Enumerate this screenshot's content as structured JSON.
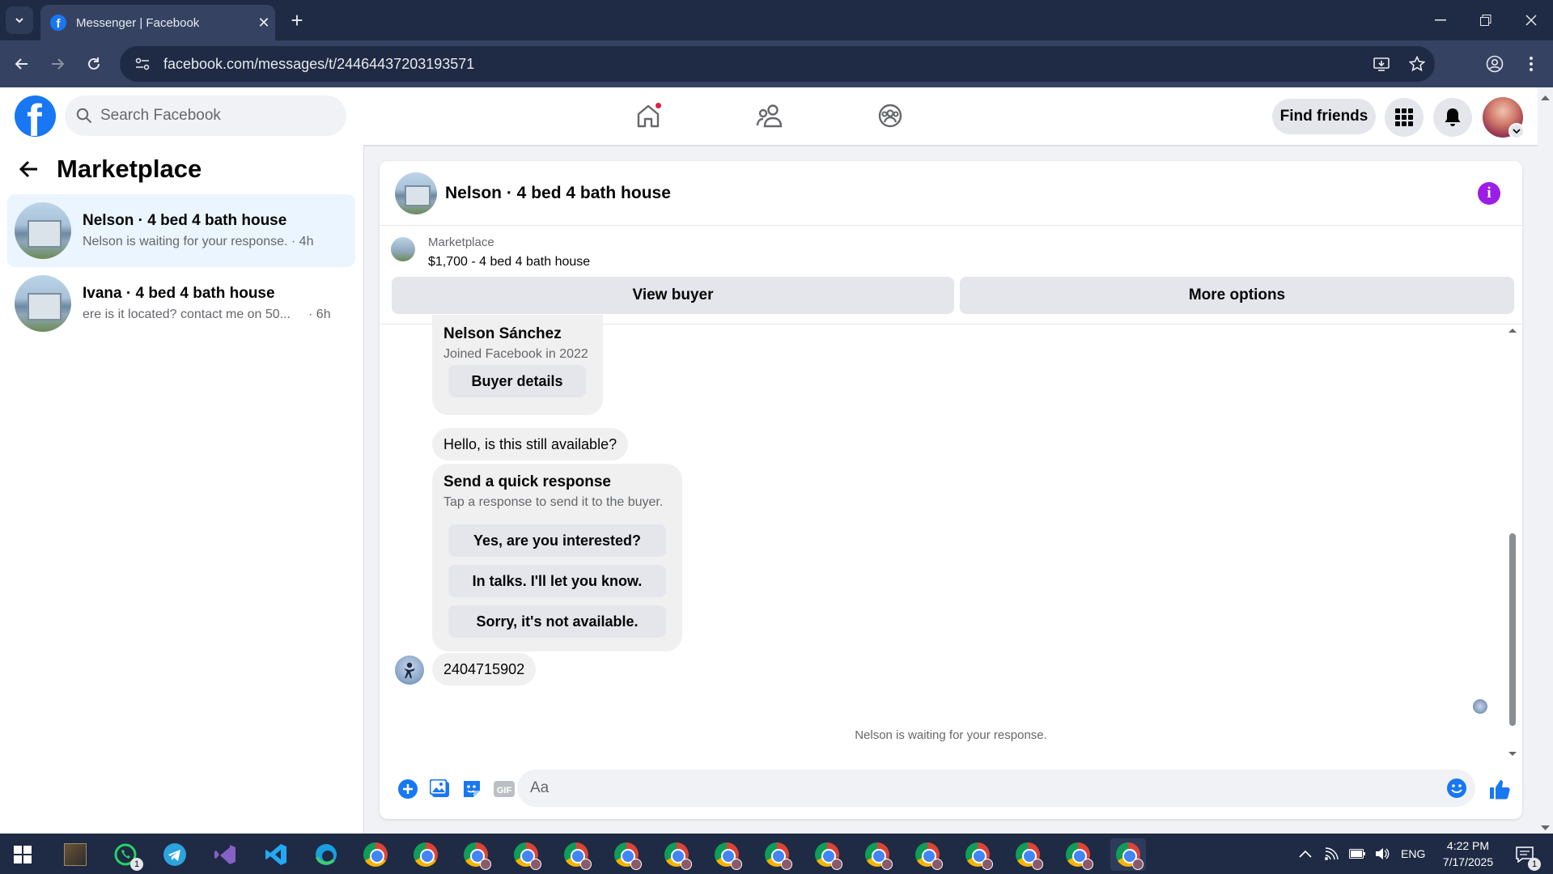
{
  "browser": {
    "tab_title": "Messenger | Facebook",
    "url": "facebook.com/messages/t/24464437203193571"
  },
  "header": {
    "search_placeholder": "Search Facebook",
    "find_friends_label": "Find friends",
    "home_has_notification": true
  },
  "sidebar": {
    "title": "Marketplace",
    "conversations": [
      {
        "name": "Nelson · 4 bed 4 bath house",
        "preview": "Nelson is waiting for your response. · 4h",
        "active": true
      },
      {
        "name": "Ivana · 4 bed 4 bath house",
        "preview": "ere is it located? contact me on 50...",
        "time": "· 6h",
        "active": false
      }
    ]
  },
  "chat": {
    "title": "Nelson · 4 bed 4 bath house",
    "listing_source": "Marketplace",
    "listing_price_title": "$1,700 - 4 bed 4 bath house",
    "view_buyer_label": "View buyer",
    "more_options_label": "More options",
    "buyer_card": {
      "name": "Nelson Sánchez",
      "joined": "Joined Facebook in 2022",
      "details_button": "Buyer details"
    },
    "message_1": "Hello, is this still available?",
    "quick_response": {
      "heading": "Send a quick response",
      "subtext": "Tap a response to send it to the buyer.",
      "options": [
        "Yes, are you interested?",
        "In talks. I'll let you know.",
        "Sorry, it's not available."
      ]
    },
    "message_2": "2404715902",
    "waiting_note": "Nelson is waiting for your response.",
    "composer_placeholder": "Aa"
  },
  "taskbar": {
    "whatsapp_badge": "1",
    "language": "ENG",
    "time": "4:22 PM",
    "date": "7/17/2025",
    "notification_badge": "1"
  },
  "colors": {
    "fb_blue": "#1877f2",
    "info_purple": "#9b1de6",
    "notification_red": "#e41e3f",
    "active_conversation_bg": "#ebf5ff"
  }
}
